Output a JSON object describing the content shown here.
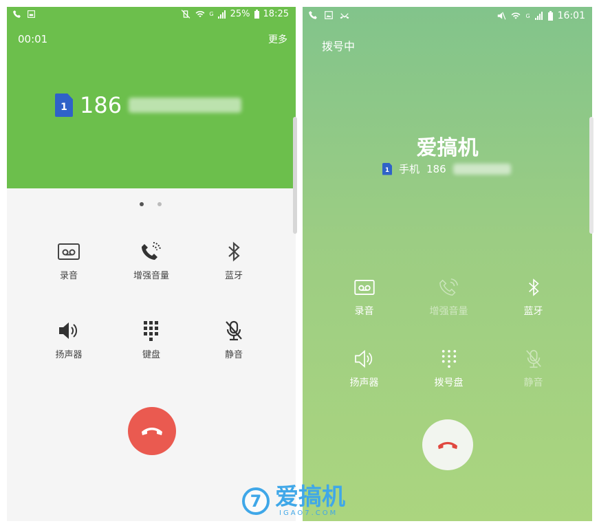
{
  "left_phone": {
    "status_bar": {
      "battery": "25%",
      "time": "18:25",
      "signal_label": "G"
    },
    "call_timer": "00:01",
    "more_label": "更多",
    "sim_label": "1",
    "number_prefix": "186",
    "buttons": [
      {
        "label": "录音",
        "icon": "voicemail-tape-icon"
      },
      {
        "label": "增强音量",
        "icon": "enhance-volume-phone-icon"
      },
      {
        "label": "蓝牙",
        "icon": "bluetooth-icon"
      },
      {
        "label": "扬声器",
        "icon": "speaker-icon"
      },
      {
        "label": "键盘",
        "icon": "keypad-icon"
      },
      {
        "label": "静音",
        "icon": "mute-mic-icon"
      }
    ],
    "colors": {
      "header": "#6cbf4c",
      "end_call": "#ea5a50"
    }
  },
  "right_phone": {
    "status_bar": {
      "time": "16:01",
      "signal_label": "G"
    },
    "call_state": "拨号中",
    "contact_name": "爱搞机",
    "sim_label": "1",
    "number_type": "手机",
    "number_prefix": "186",
    "buttons": [
      {
        "label": "录音",
        "icon": "voicemail-tape-icon",
        "enabled": true
      },
      {
        "label": "增强音量",
        "icon": "enhance-volume-phone-icon",
        "enabled": false
      },
      {
        "label": "蓝牙",
        "icon": "bluetooth-icon",
        "enabled": true
      },
      {
        "label": "扬声器",
        "icon": "speaker-icon",
        "enabled": true
      },
      {
        "label": "拨号盘",
        "icon": "keypad-icon",
        "enabled": true
      },
      {
        "label": "静音",
        "icon": "mute-mic-icon",
        "enabled": false
      }
    ],
    "colors": {
      "gradient_top": "#82c48b",
      "gradient_bottom": "#abd57f",
      "end_call": "#e0483f"
    }
  },
  "watermark": {
    "logo_char": "7",
    "brand": "爱搞机",
    "domain": "IGAO7.COM"
  }
}
